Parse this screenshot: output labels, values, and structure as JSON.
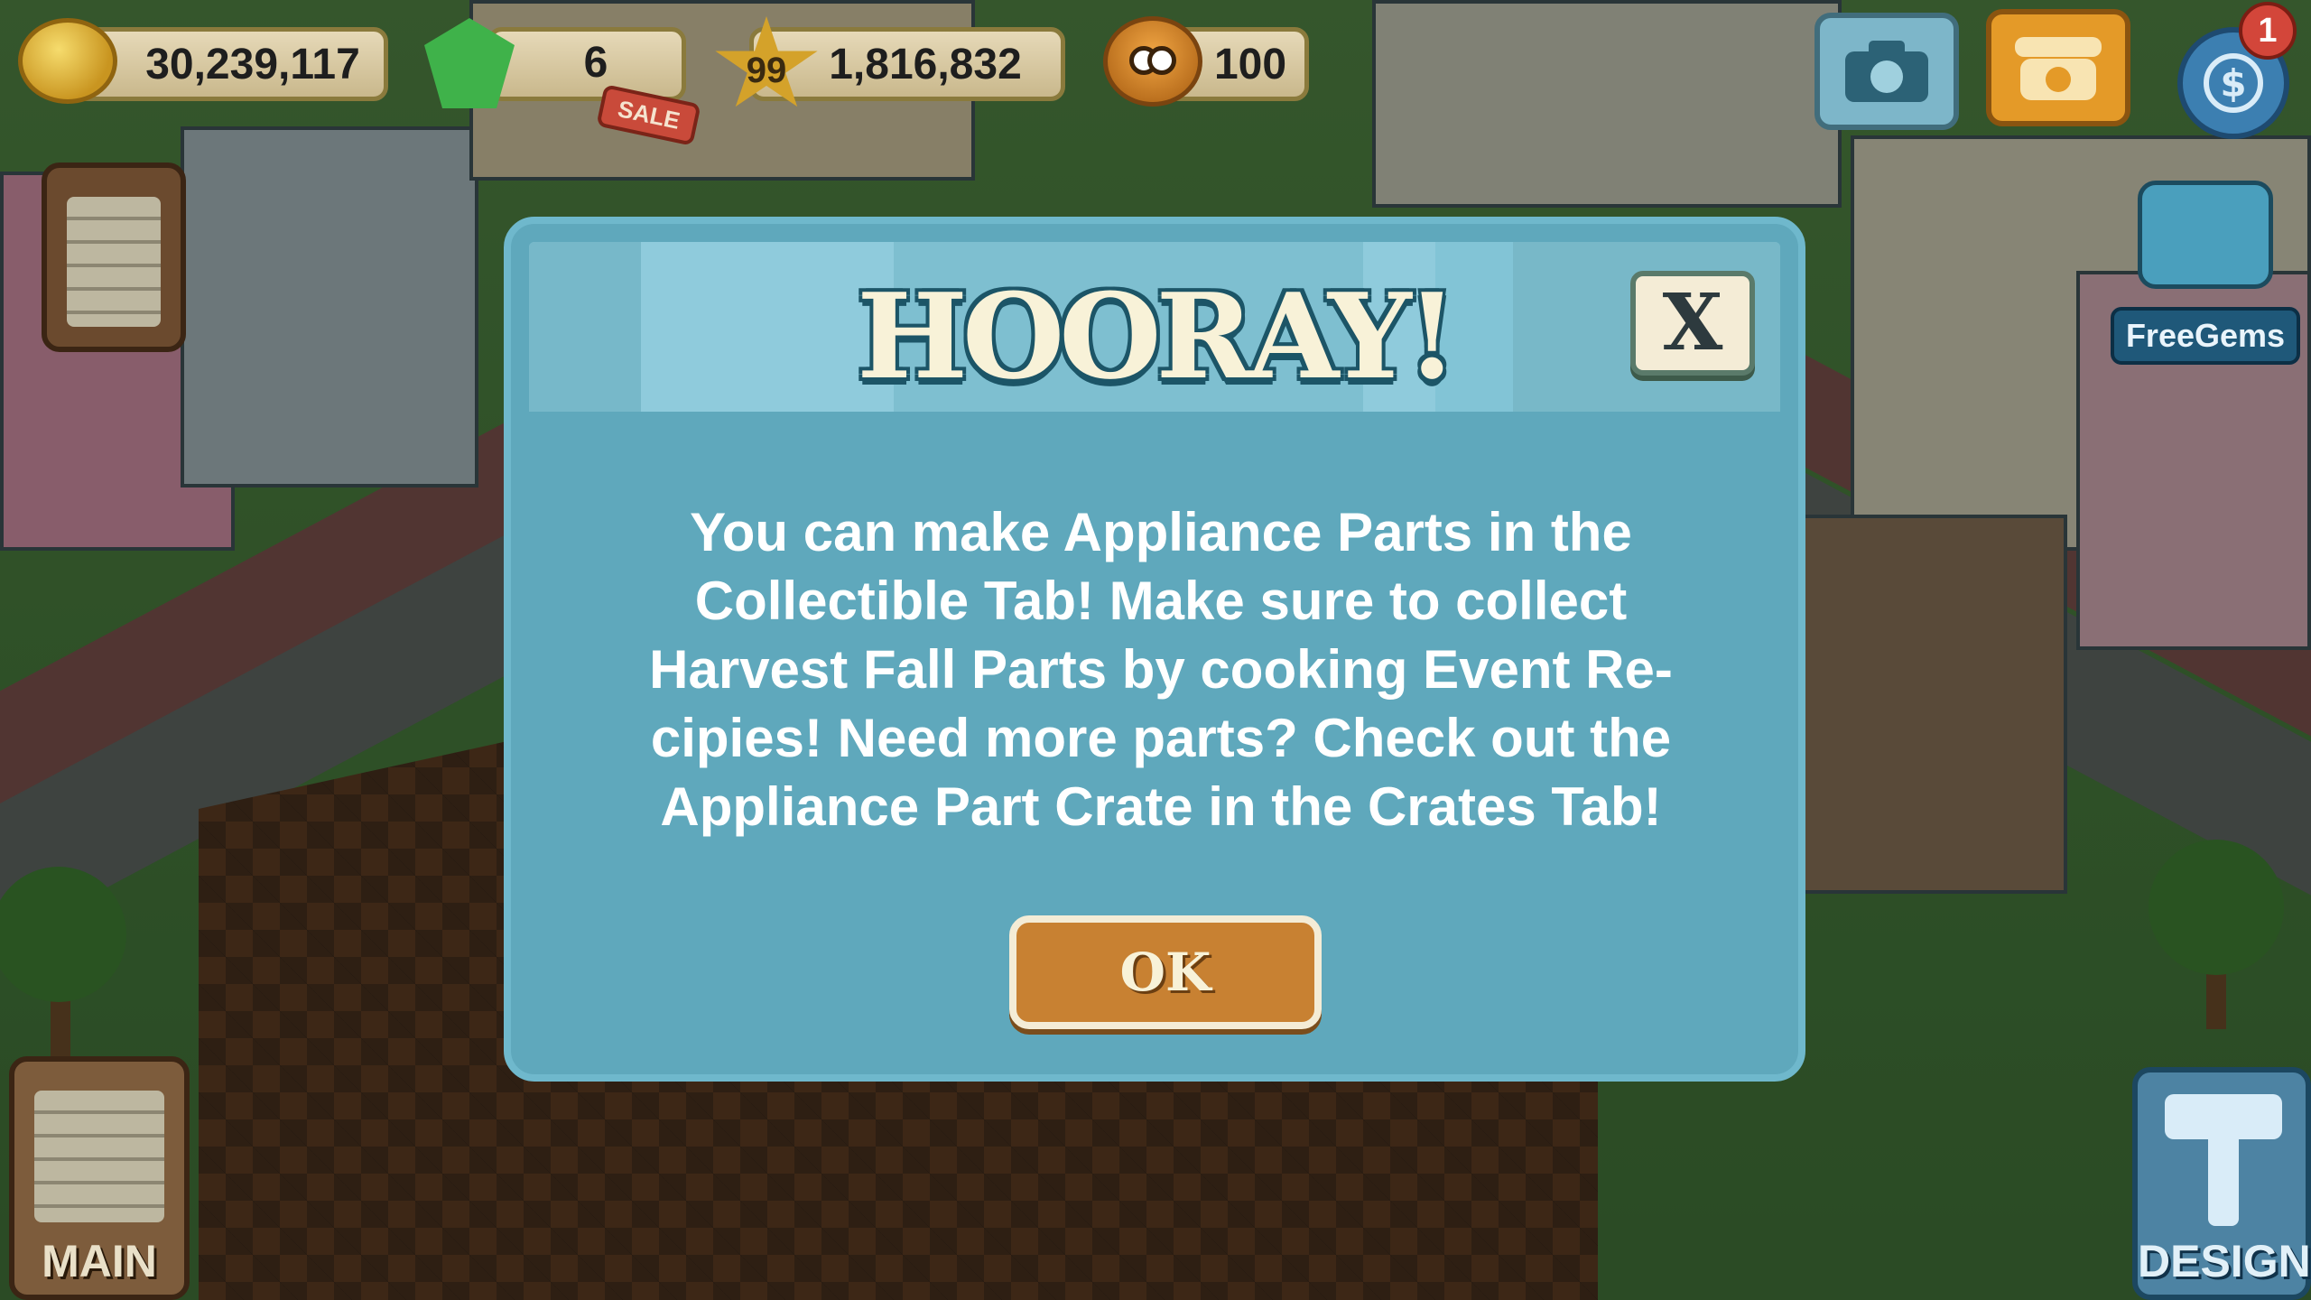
{
  "hud": {
    "coins": "30,239,117",
    "gems": "6",
    "sale_label": "SALE",
    "level": "99",
    "xp": "1,816,832",
    "energy": "100",
    "notification_count": "1",
    "free_gems_label": "FreeGems"
  },
  "side_buttons": {
    "main_label": "MAIN",
    "design_label": "DESIGN"
  },
  "dialog": {
    "title": "HOORAY!",
    "close_label": "X",
    "message": "You can make Appliance Parts in the Collectible Tab! Make sure to collect Harvest Fall Parts by cooking Event Re- cipies! Need more parts? Check out the Appliance Part Crate in the Crates Tab!",
    "ok_label": "OK"
  },
  "colors": {
    "dialog_bg": "#5fa8bc",
    "header_bg": "#8fcbdc",
    "ok_button": "#c88132"
  }
}
